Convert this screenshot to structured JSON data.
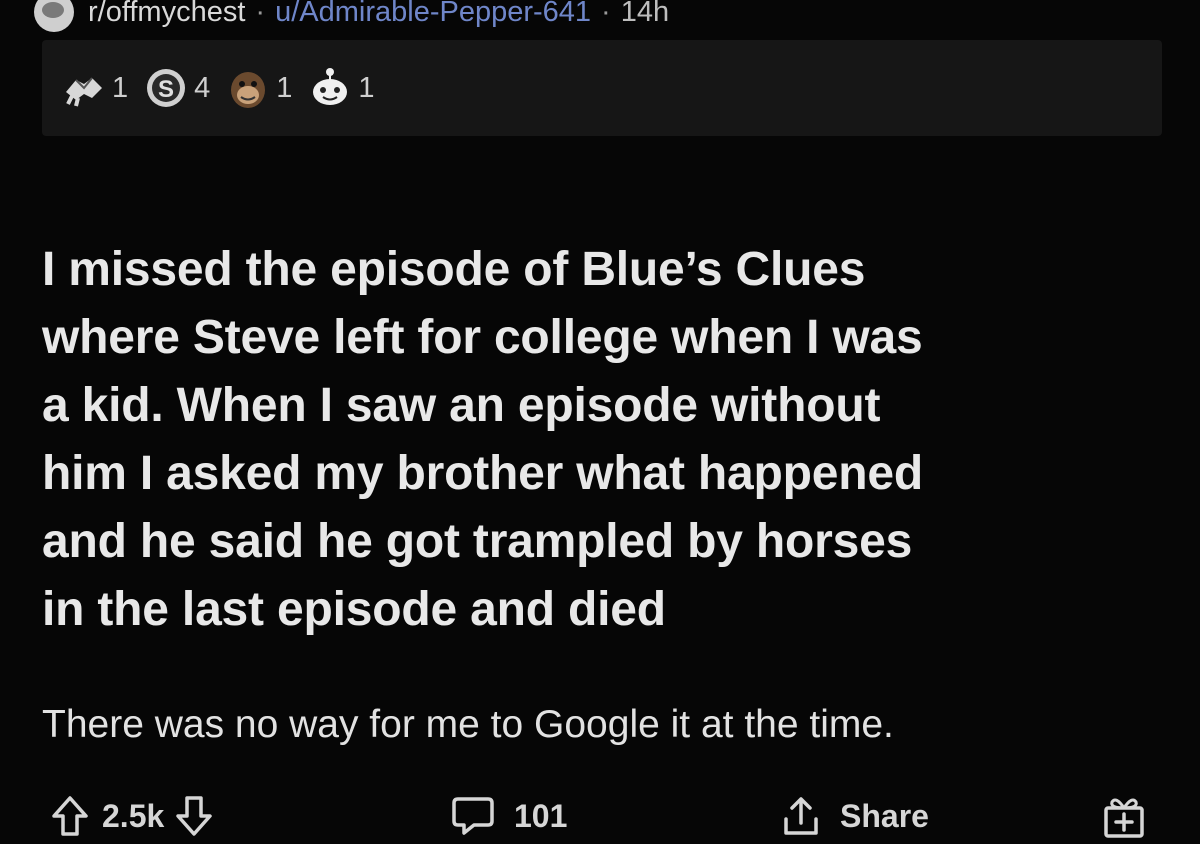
{
  "post": {
    "subreddit": "r/offmychest",
    "separator": "·",
    "username": "u/Admirable-Pepper-641",
    "time": "14h",
    "awards": [
      {
        "icon": "handshake-award-icon",
        "count": "1"
      },
      {
        "icon": "silver-coin-award-icon",
        "count": "4"
      },
      {
        "icon": "monkey-award-icon",
        "count": "1"
      },
      {
        "icon": "snoo-face-award-icon",
        "count": "1"
      }
    ],
    "title_lines": [
      "I missed the episode of Blue’s Clues",
      "where Steve left for college when I was",
      "a kid. When I saw an episode without",
      "him I asked my brother what happened",
      "and he said he got trampled by horses",
      "in the last episode and died"
    ],
    "body": "There was no way for me to Google it at the time."
  },
  "actions": {
    "vote_count": "2.5k",
    "comment_count": "101",
    "share_label": "Share",
    "upvote_icon": "upvote-arrow-icon",
    "downvote_icon": "downvote-arrow-icon",
    "comment_icon": "comment-bubble-icon",
    "share_icon": "share-icon",
    "gift_icon": "gift-award-icon"
  },
  "colors": {
    "background": "#060606",
    "awards_bar": "#161616",
    "username": "#6f86c9",
    "text": "#e8e8e8"
  }
}
